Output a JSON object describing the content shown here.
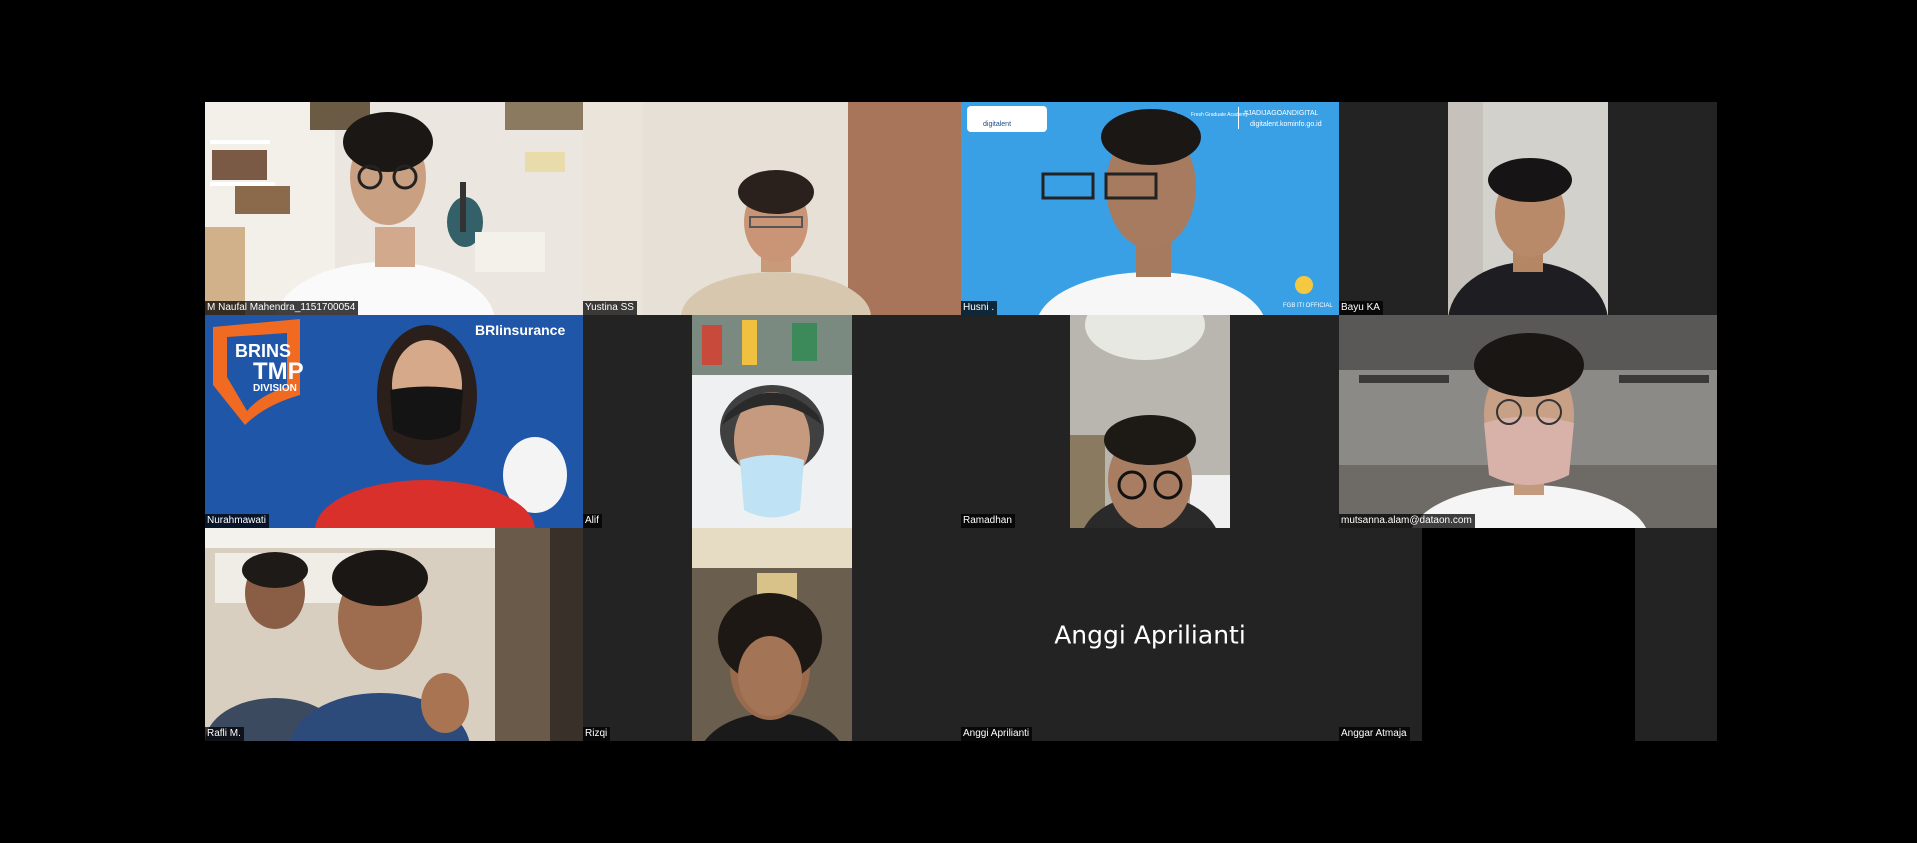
{
  "meeting": {
    "participants": [
      {
        "name": "M Naufal Mahendra_1151700054"
      },
      {
        "name": "Yustina SS"
      },
      {
        "name": "Husni ."
      },
      {
        "name": "Bayu KA"
      },
      {
        "name": "Nurahmawati"
      },
      {
        "name": "Alif"
      },
      {
        "name": "Ramadhan"
      },
      {
        "name": "mutsanna.alam@dataon.com"
      },
      {
        "name": "Rafli M."
      },
      {
        "name": "Rizqi"
      },
      {
        "name": "Anggi Aprilianti"
      },
      {
        "name": "Anggar Atmaja"
      }
    ],
    "video_off_display_name": "Anggi Aprilianti"
  },
  "overlays": {
    "brins_line1": "BRINS",
    "brins_line2": "TMP",
    "brins_line3": "DIVISION",
    "bri_logo": "BRIinsurance",
    "dta_hashtag": "#JADIJAGOANDIGITAL",
    "dta_url": "digitalent.kominfo.go.id",
    "dta_brand": "digitalent",
    "dta_academy": "Fresh Graduate Academy",
    "dta_footer": "FGB ITI OFFICIAL",
    "dta_letters": "A"
  },
  "colors": {
    "background": "#000000",
    "tile_bg": "#232323",
    "brins_blue": "#1f56a8",
    "brins_orange": "#f06a22",
    "dta_blue": "#3aa0e6"
  }
}
